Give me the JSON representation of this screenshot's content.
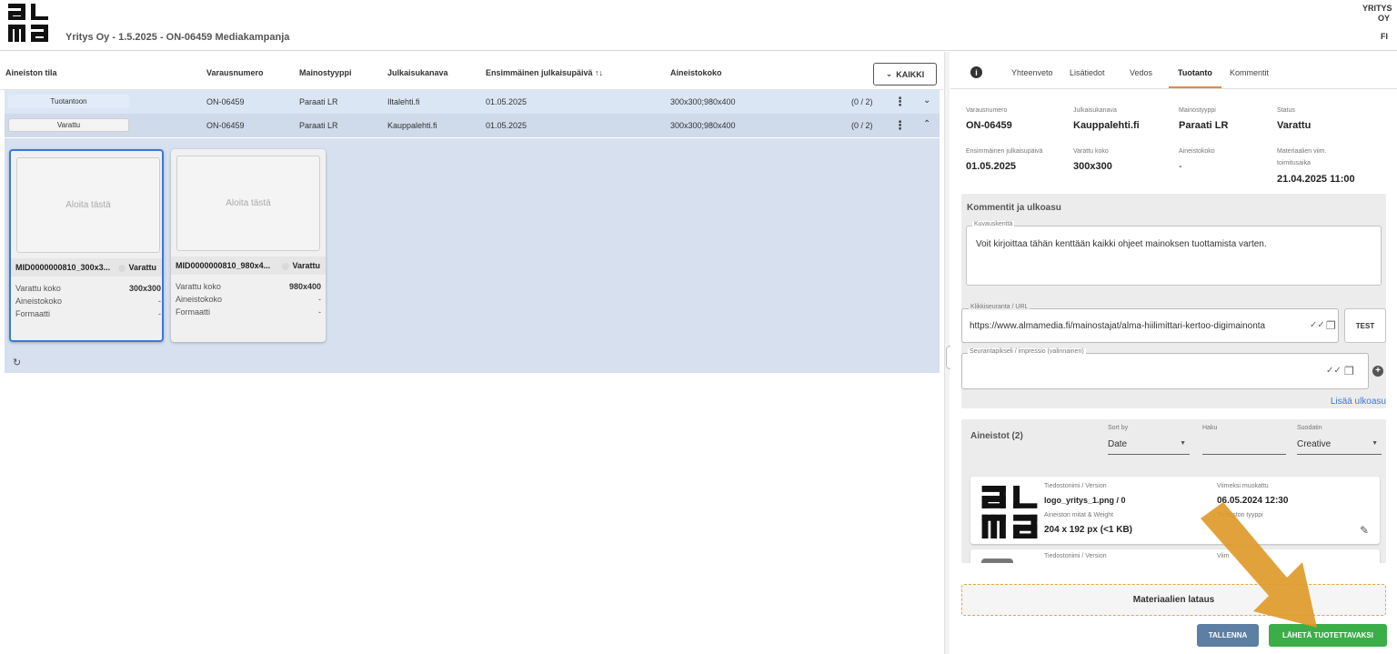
{
  "header": {
    "title": "Yritys Oy - 1.5.2025 - ON-06459 Mediakampanja",
    "company": "YRITYS OY",
    "language": "FI"
  },
  "table": {
    "columns": [
      "Aineiston tila",
      "Varausnumero",
      "Mainostyyppi",
      "Julkaisukanava",
      "Ensimmäinen julkaisupäivä ↑↓",
      "Aineistokoko"
    ],
    "filter_button": "KAIKKI",
    "rows": [
      {
        "status": "Tuotantoon",
        "booking": "ON-06459",
        "ad_type": "Paraati LR",
        "channel": "Iltalehti.fi",
        "first_date": "01.05.2025",
        "size": "300x300;980x400",
        "count": "(0 / 2)"
      },
      {
        "status": "Varattu",
        "booking": "ON-06459",
        "ad_type": "Paraati LR",
        "channel": "Kauppalehti.fi",
        "first_date": "01.05.2025",
        "size": "300x300;980x400",
        "count": "(0 / 2)"
      }
    ]
  },
  "cards": [
    {
      "placeholder": "Aloita tästä",
      "title": "MID0000000810_300x3...",
      "status": "Varattu",
      "reserved_label": "Varattu koko",
      "reserved_value": "300x300",
      "size_label": "Aineistokoko",
      "size_value": "-",
      "format_label": "Formaatti",
      "format_value": "-"
    },
    {
      "placeholder": "Aloita tästä",
      "title": "MID0000000810_980x4...",
      "status": "Varattu",
      "reserved_label": "Varattu koko",
      "reserved_value": "980x400",
      "size_label": "Aineistokoko",
      "size_value": "-",
      "format_label": "Formaatti",
      "format_value": "-"
    }
  ],
  "tabs": [
    "Yhteenveto",
    "Lisätiedot",
    "Vedos",
    "Tuotanto",
    "Kommentit"
  ],
  "details": {
    "booking_label": "Varausnumero",
    "booking_value": "ON-06459",
    "channel_label": "Julkaisukanava",
    "channel_value": "Kauppalehti.fi",
    "adtype_label": "Mainostyyppi",
    "adtype_value": "Paraati LR",
    "status_label": "Status",
    "status_value": "Varattu",
    "first_date_label": "Ensimmäinen julkaisupäivä",
    "first_date_value": "01.05.2025",
    "reserved_size_label": "Varattu koko",
    "reserved_size_value": "300x300",
    "material_size_label": "Aineistokoko",
    "material_size_value": "-",
    "delivery_label_1": "Materiaalien viim.",
    "delivery_label_2": "toimitusaika",
    "delivery_value": "21.04.2025 11:00"
  },
  "comments": {
    "title": "Kommentit ja ulkoasu",
    "desc_label": "Kuvauskenttä",
    "desc_text": "Voit kirjoittaa tähän kenttään kaikki ohjeet mainoksen tuottamista varten.",
    "click_label": "Klikkiseuranta / URL",
    "click_value": "https://www.almamedia.fi/mainostajat/alma-hiilimittari-kertoo-digimainonta",
    "test_button": "TEST",
    "pixel_label": "Seurantapikseli / impressio (valinnainen)",
    "add_layout": "Lisää ulkoasu"
  },
  "materials": {
    "title": "Aineistot (2)",
    "sort_label": "Sort by",
    "sort_value": "Date",
    "search_label": "Haku",
    "filter_label": "Suodatin",
    "filter_value": "Creative",
    "items": [
      {
        "file_label": "Tiedostonimi / Version",
        "file_value": "logo_yritys_1.png / 0",
        "modified_label": "Viimeksi muokattu",
        "modified_value": "06.05.2024 12:30",
        "dims_label": "Aineiston mitat & Weight",
        "dims_value": "204 x 192 px (<1 KB)",
        "type_label": "Tiedoston tyyppi"
      },
      {
        "file_label": "Tiedostonimi / Version",
        "modified_label": "Viim"
      }
    ]
  },
  "actions": {
    "upload": "Materiaalien lataus",
    "save": "TALLENNA",
    "send": "LÄHETÄ TUOTETTAVAKSI"
  },
  "colors": {
    "accent": "#e8883a",
    "primary_blue": "#3a79d8",
    "save_button": "#5c7fa3",
    "send_button": "#3cae48",
    "arrow": "#e09a2a"
  }
}
